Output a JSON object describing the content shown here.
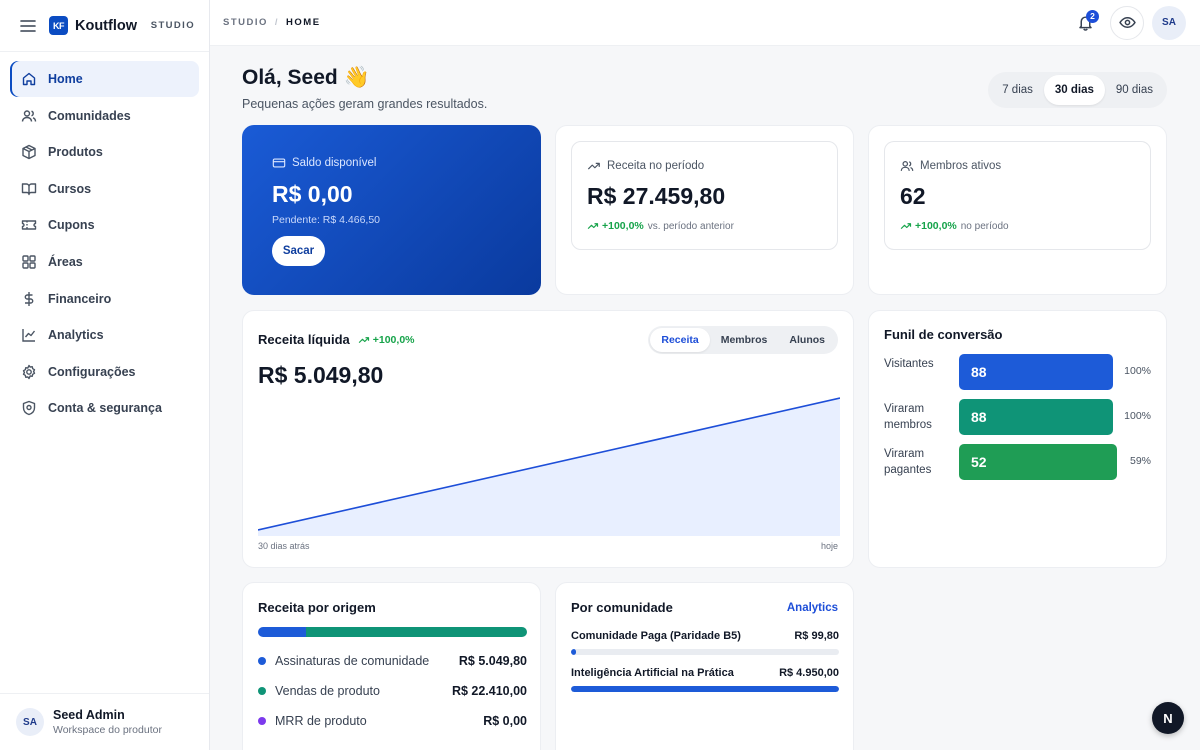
{
  "sidebar": {
    "brand_logo": "KF",
    "brand": "Koutflow",
    "tag": "STUDIO",
    "items": [
      {
        "label": "Home",
        "icon": "home-icon",
        "active": true
      },
      {
        "label": "Comunidades",
        "icon": "users-icon"
      },
      {
        "label": "Produtos",
        "icon": "package-icon"
      },
      {
        "label": "Cursos",
        "icon": "book-icon"
      },
      {
        "label": "Cupons",
        "icon": "ticket-icon"
      },
      {
        "label": "Áreas",
        "icon": "grid-icon"
      },
      {
        "label": "Financeiro",
        "icon": "dollar-icon"
      },
      {
        "label": "Analytics",
        "icon": "line-chart-icon"
      },
      {
        "label": "Configurações",
        "icon": "gear-icon"
      },
      {
        "label": "Conta & segurança",
        "icon": "shield-icon"
      }
    ],
    "user": {
      "initials": "SA",
      "name": "Seed Admin",
      "subtitle": "Workspace do produtor"
    }
  },
  "topbar": {
    "crumbs": [
      "STUDIO",
      "HOME"
    ],
    "crumb_sep": "/",
    "notifications_count": "2",
    "avatar_initials": "SA"
  },
  "greeting": {
    "title": "Olá, Seed 👋",
    "subtitle": "Pequenas ações geram grandes resultados."
  },
  "period": {
    "options": [
      "7 dias",
      "30 dias",
      "90 dias"
    ],
    "selected": "30 dias"
  },
  "balance": {
    "label": "Saldo disponível",
    "value": "R$ 0,00",
    "pending": "Pendente: R$ 4.466,50",
    "button": "Sacar"
  },
  "kpis": {
    "receita": {
      "label": "Receita no período",
      "value": "R$ 27.459,80",
      "delta": "+100,0%",
      "note": "vs. período anterior"
    },
    "membros": {
      "label": "Membros ativos",
      "value": "62",
      "delta": "+100,0%",
      "note": "no período"
    }
  },
  "receita_liquida": {
    "title": "Receita líquida",
    "delta": "+100,0%",
    "value": "R$ 5.049,80",
    "tabs": [
      "Receita",
      "Membros",
      "Alunos"
    ],
    "selected_tab": "Receita",
    "x_start": "30 dias atrás",
    "x_end": "hoje",
    "colors": {
      "line": "#1d4ed8",
      "fill": "#e8efff"
    }
  },
  "chart_data": {
    "type": "area",
    "x": [
      "30 dias atrás",
      "hoje"
    ],
    "y": [
      0,
      5049.8
    ],
    "ylim": [
      0,
      5049.8
    ]
  },
  "funil": {
    "title": "Funil de conversão",
    "rows": [
      {
        "label": "Visitantes",
        "value": "88",
        "pct": "100%",
        "color": "#1d5bd8",
        "ratio": 1.0
      },
      {
        "label": "Viraram membros",
        "value": "88",
        "pct": "100%",
        "color": "#0f9477",
        "ratio": 1.0
      },
      {
        "label": "Viraram pagantes",
        "value": "52",
        "pct": "59%",
        "color": "#1f9d55",
        "ratio": 1.03
      }
    ]
  },
  "origem": {
    "title": "Receita por origem",
    "items": [
      {
        "label": "Assinaturas de comunidade",
        "value": "R$ 5.049,80",
        "color": "#1d5bd8",
        "share": 0.18
      },
      {
        "label": "Vendas de produto",
        "value": "R$ 22.410,00",
        "color": "#0f9477",
        "share": 0.82
      },
      {
        "label": "MRR de produto",
        "value": "R$ 0,00",
        "color": "#7c3aed",
        "share": 0
      }
    ]
  },
  "comunidade": {
    "title": "Por comunidade",
    "link": "Analytics",
    "items": [
      {
        "name": "Comunidade Paga (Paridade B5)",
        "value": "R$ 99,80",
        "share": 0.02
      },
      {
        "name": "Inteligência Artificial na Prática",
        "value": "R$ 4.950,00",
        "share": 1.0
      }
    ]
  },
  "fab_label": "N"
}
